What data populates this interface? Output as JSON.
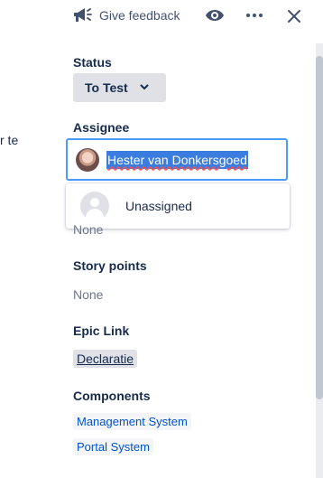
{
  "left_partial_text": "r te",
  "topbar": {
    "feedback_label": "Give feedback",
    "icons": [
      "megaphone-icon",
      "eye-icon",
      "more-icon",
      "close-icon"
    ]
  },
  "fields": {
    "status": {
      "label": "Status",
      "value": "To Test"
    },
    "assignee": {
      "label": "Assignee",
      "value": "Hester van Donkersgoed",
      "dropdown_option": "Unassigned"
    },
    "hidden_value": "None",
    "story_points": {
      "label": "Story points",
      "value": "None"
    },
    "epic_link": {
      "label": "Epic Link",
      "value": "Declaratie"
    },
    "components": {
      "label": "Components",
      "values": [
        "Management System",
        "Portal System"
      ]
    }
  },
  "colors": {
    "selection": "#3a7dde",
    "focus_border": "#4c9aff",
    "link": "#0052cc",
    "muted_text": "#6b778c",
    "button_bg": "#dfe1e6"
  }
}
